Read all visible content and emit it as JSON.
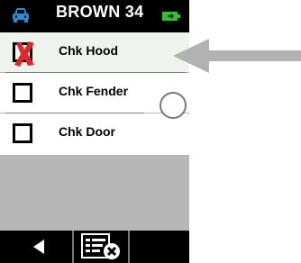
{
  "header": {
    "title": "BROWN 34",
    "car_icon": "car-icon",
    "battery_icon": "battery-icon",
    "accent_color": "#1f8fd8",
    "battery_color": "#28c828"
  },
  "checklist": {
    "items": [
      {
        "label": "Chk Hood",
        "state": "failed",
        "icon": "x-mark-icon"
      },
      {
        "label": "Chk Fender",
        "state": "unchecked"
      },
      {
        "label": "Chk Door",
        "state": "unchecked"
      }
    ],
    "fail_color": "#e0282a"
  },
  "toolbar": {
    "back_icon": "back-arrow-icon",
    "clear_icon": "clear-checklist-icon"
  },
  "annotation": {
    "icon": "pointer-arrow",
    "color": "#b2b2b2"
  }
}
